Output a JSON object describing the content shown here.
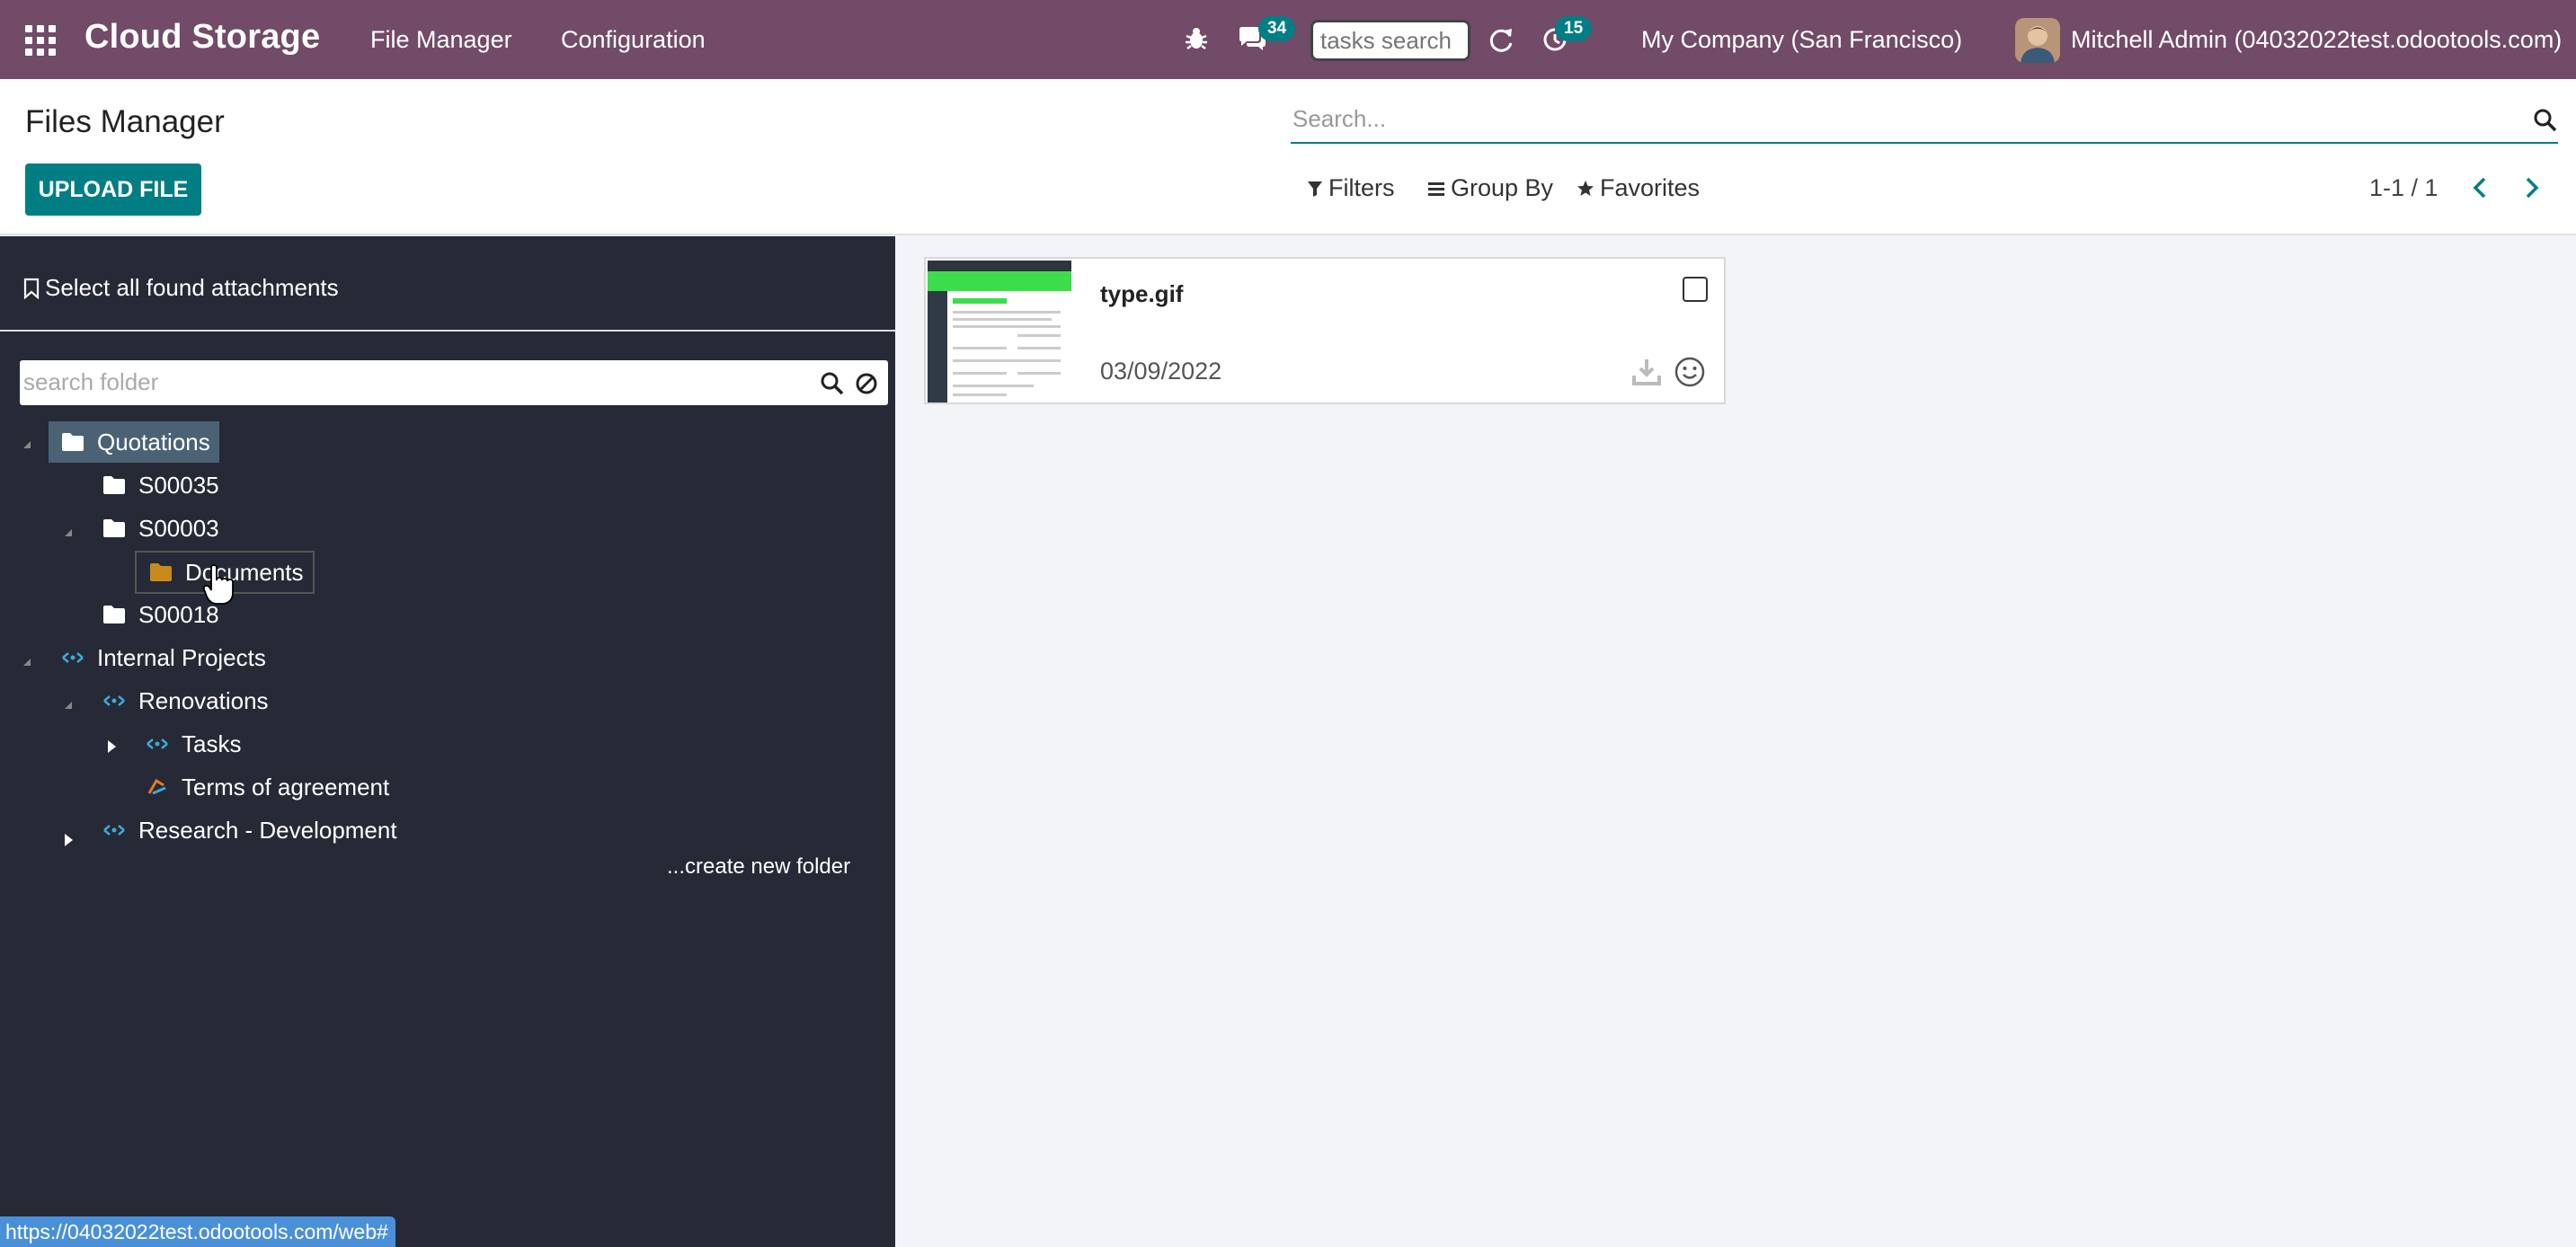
{
  "navbar": {
    "brand": "Cloud Storage",
    "menu": [
      "File Manager",
      "Configuration"
    ],
    "messages_count": "34",
    "activities_count": "15",
    "tasks_search_placeholder": "tasks search",
    "company": "My Company (San Francisco)",
    "user": "Mitchell Admin (04032022test.odootools.com)"
  },
  "control_panel": {
    "title": "Files Manager",
    "upload_label": "UPLOAD FILE",
    "search_placeholder": "Search...",
    "filters_label": "Filters",
    "groupby_label": "Group By",
    "favorites_label": "Favorites",
    "pager": "1-1 / 1"
  },
  "sidebar": {
    "select_all_label": "Select all found attachments",
    "folder_search_placeholder": "search folder",
    "tree": {
      "quotations": "Quotations",
      "s00035": "S00035",
      "s00003": "S00003",
      "documents": "Documents",
      "s00018": "S00018",
      "internal_projects": "Internal Projects",
      "renovations": "Renovations",
      "tasks": "Tasks",
      "terms": "Terms of agreement",
      "research": "Research - Development"
    },
    "create_folder_label": "...create new folder"
  },
  "files": [
    {
      "name": "type.gif",
      "date": "03/09/2022"
    }
  ],
  "status_url": "https://04032022test.odootools.com/web#",
  "colors": {
    "navbar": "#714b67",
    "accent": "#017e84",
    "sidebar_bg": "#262a36",
    "selected_node": "#4b6275",
    "project_icon": "#3fa9d8",
    "documents_folder": "#c98a1c"
  },
  "icons": {
    "apps": "grid-icon",
    "bug": "bug-icon",
    "messages": "chat-icon",
    "refresh": "refresh-icon",
    "activities": "clock-icon",
    "folder": "folder-icon",
    "project": "project-icon",
    "download": "download-icon",
    "smile": "smile-icon"
  }
}
